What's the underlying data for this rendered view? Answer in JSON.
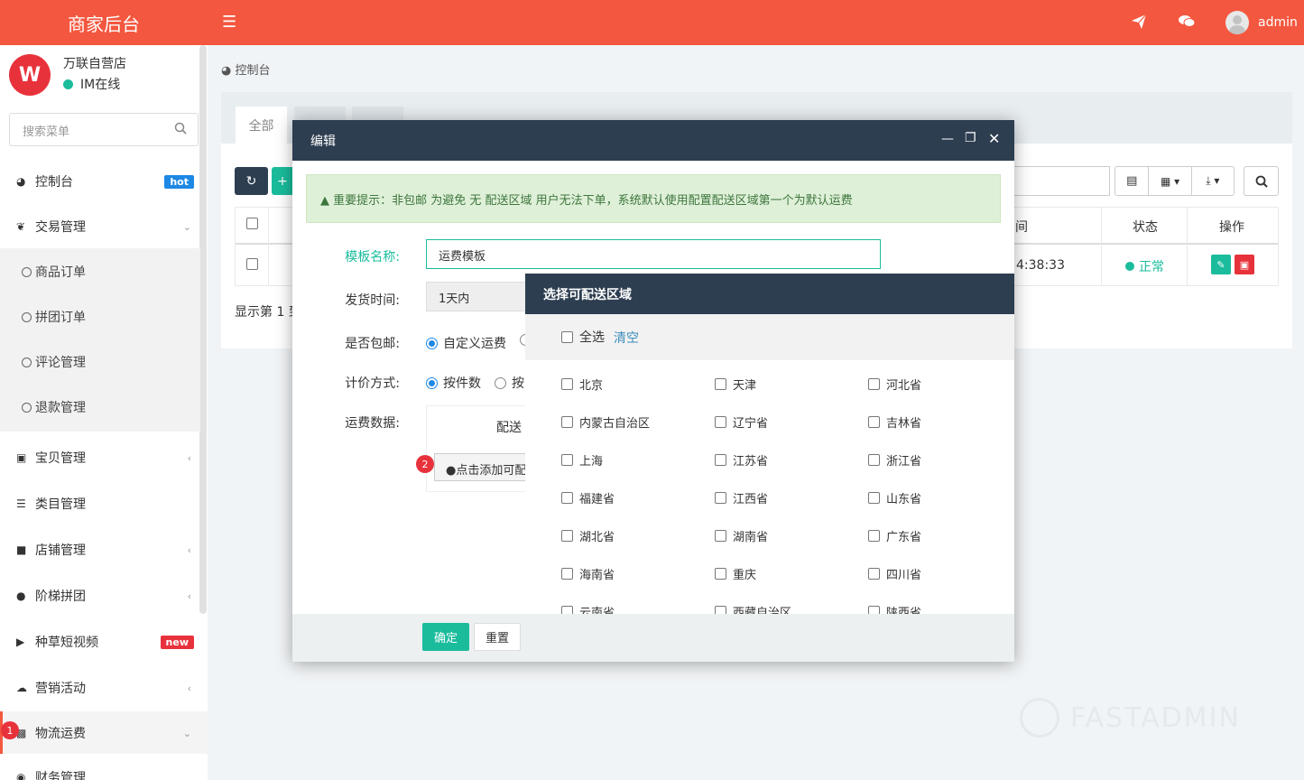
{
  "header": {
    "brand": "商家后台",
    "username": "admin"
  },
  "shop": {
    "name": "万联自营店",
    "status": "IM在线"
  },
  "sidebar": {
    "search_placeholder": "搜索菜单",
    "items": [
      {
        "label": "控制台",
        "badge": "hot"
      },
      {
        "label": "交易管理"
      },
      {
        "label": "宝贝管理"
      },
      {
        "label": "类目管理"
      },
      {
        "label": "店铺管理"
      },
      {
        "label": "阶梯拼团"
      },
      {
        "label": "种草短视频",
        "badge": "new"
      },
      {
        "label": "营销活动"
      },
      {
        "label": "物流运费"
      },
      {
        "label": "财务管理"
      }
    ],
    "sub_items": [
      "商品订单",
      "拼团订单",
      "评论管理",
      "退款管理"
    ],
    "marker": "1"
  },
  "breadcrumb": "控制台",
  "panel": {
    "tabs": [
      "全部"
    ],
    "columns": {
      "status": "状态",
      "action": "操作",
      "time_fragment": "间"
    },
    "row": {
      "time_fragment": "4:38:33",
      "status": "正常"
    },
    "footer_text": "显示第 1 到"
  },
  "edit_modal": {
    "title": "编辑",
    "alert": "重要提示：非包邮 为避免 无 配送区域 用户无法下单，系统默认使用配置配送区域第一个为默认运费",
    "fields": {
      "template_name_label": "模板名称:",
      "template_name_value": "运费模板",
      "ship_time_label": "发货时间:",
      "ship_time_value": "1天内",
      "free_ship_label": "是否包邮:",
      "free_ship_option": "自定义运费",
      "pricing_label": "计价方式:",
      "pricing_option1": "按件数",
      "pricing_option2": "按",
      "fee_data_label": "运费数据:",
      "fee_column_fragment": "配送",
      "add_region_button": "点击添加可配",
      "marker": "2"
    },
    "confirm_button": "确定",
    "reset_button": "重置"
  },
  "region_popup": {
    "title": "选择可配送区域",
    "select_all": "全选",
    "clear": "清空",
    "regions": [
      "北京",
      "天津",
      "河北省",
      "内蒙古自治区",
      "辽宁省",
      "吉林省",
      "上海",
      "江苏省",
      "浙江省",
      "福建省",
      "江西省",
      "山东省",
      "湖北省",
      "湖南省",
      "广东省",
      "海南省",
      "重庆",
      "四川省",
      "云南省",
      "西藏自治区",
      "陕西省"
    ]
  },
  "colors": {
    "topbar": "#f4573f",
    "modal_header": "#2d3e50",
    "accent_green": "#1abc9c",
    "hot_badge": "#1e88e5",
    "new_badge": "#e8323b"
  }
}
